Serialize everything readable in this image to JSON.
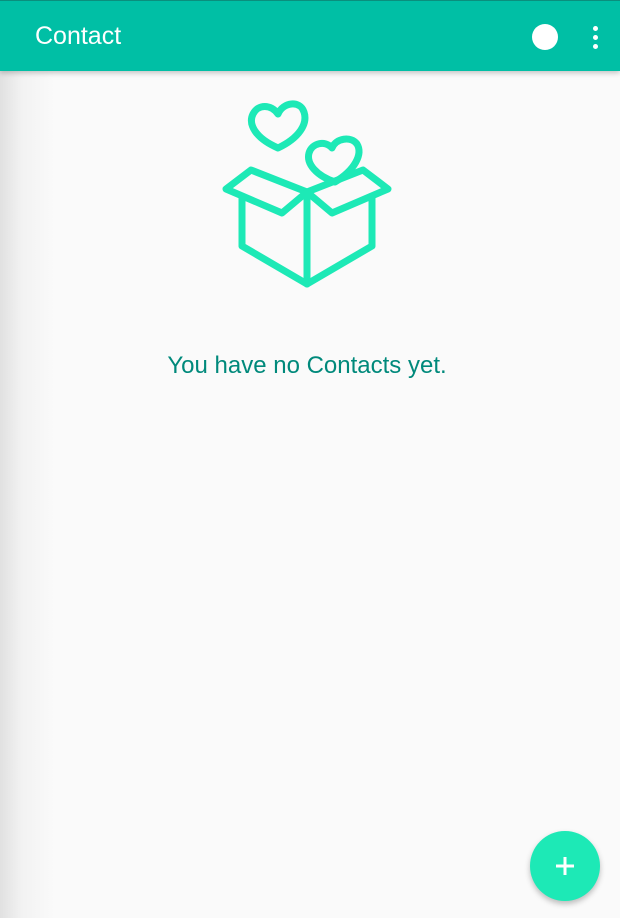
{
  "appbar": {
    "title": "Contact",
    "status_icon": "white-circle-icon",
    "overflow_icon": "more-vert-icon"
  },
  "empty_state": {
    "illustration": "gift-box-hearts-icon",
    "message": "You have no Contacts yet."
  },
  "fab": {
    "icon": "plus-icon"
  },
  "colors": {
    "primary": "#00bfa5",
    "accent": "#1de9b6",
    "text_accent": "#00897b",
    "background": "#fafafa"
  }
}
